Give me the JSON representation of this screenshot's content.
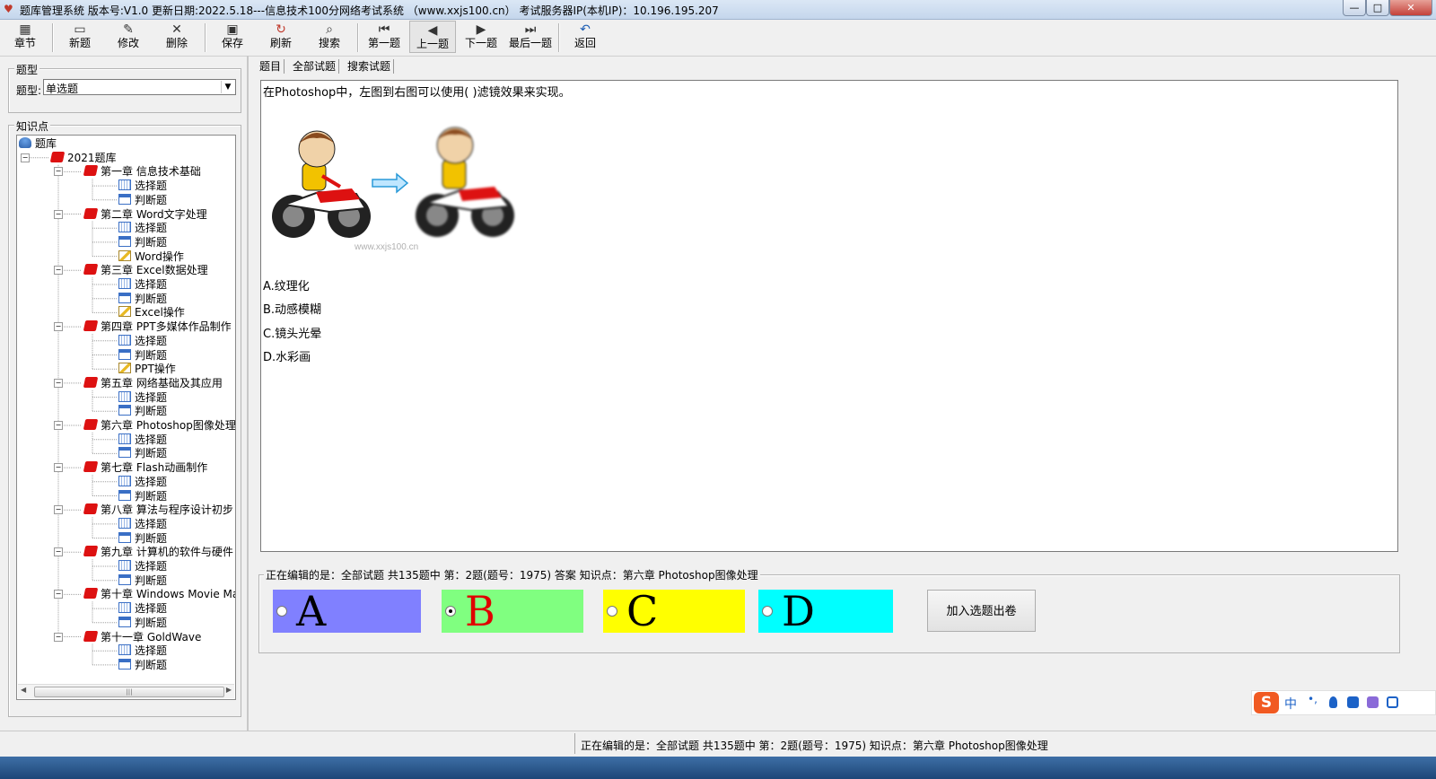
{
  "window": {
    "title": "题库管理系统 版本号:V1.0 更新日期:2022.5.18---信息技术100分网络考试系统 （www.xxjs100.cn） 考试服务器IP(本机IP)：10.196.195.207",
    "min_glyph": "—",
    "max_glyph": "□",
    "close_glyph": "✕"
  },
  "toolbar": {
    "chapter": "章节",
    "new": "新题",
    "modify": "修改",
    "delete": "删除",
    "save": "保存",
    "refresh": "刷新",
    "search": "搜索",
    "first": "第一题",
    "prev": "上一题",
    "next": "下一题",
    "last": "最后一题",
    "back": "返回"
  },
  "left": {
    "type_group_label": "题型",
    "type_label": "题型:",
    "type_value": "单选题",
    "knowledge_label": "知识点",
    "tree": {
      "root": "题库",
      "bank": "2021题库",
      "chapters": [
        {
          "label": "第一章 信息技术基础",
          "children": [
            "选择题",
            "判断题"
          ]
        },
        {
          "label": "第二章 Word文字处理",
          "children": [
            "选择题",
            "判断题",
            "Word操作"
          ]
        },
        {
          "label": "第三章 Excel数据处理",
          "children": [
            "选择题",
            "判断题",
            "Excel操作"
          ]
        },
        {
          "label": "第四章 PPT多媒体作品制作",
          "children": [
            "选择题",
            "判断题",
            "PPT操作"
          ]
        },
        {
          "label": "第五章 网络基础及其应用",
          "children": [
            "选择题",
            "判断题"
          ]
        },
        {
          "label": "第六章 Photoshop图像处理",
          "children": [
            "选择题",
            "判断题"
          ]
        },
        {
          "label": "第七章 Flash动画制作",
          "children": [
            "选择题",
            "判断题"
          ]
        },
        {
          "label": "第八章 算法与程序设计初步",
          "children": [
            "选择题",
            "判断题"
          ]
        },
        {
          "label": "第九章 计算机的软件与硬件",
          "children": [
            "选择题",
            "判断题"
          ]
        },
        {
          "label": "第十章 Windows Movie Maker",
          "children": [
            "选择题",
            "判断题"
          ]
        },
        {
          "label": "第十一章 GoldWave",
          "children": [
            "选择题",
            "判断题"
          ]
        }
      ]
    }
  },
  "tabs": [
    "题目",
    "全部试题",
    "搜索试题"
  ],
  "question": {
    "text": "在Photoshop中，左图到右图可以使用( )滤镜效果来实现。",
    "watermark": "www.xxjs100.cn",
    "options": [
      "A.纹理化",
      "B.动感模糊",
      "C.镜头光晕",
      "D.水彩画"
    ]
  },
  "editing": {
    "legend": "正在编辑的是：全部试题 共135题中  第：2题(题号：1975) 答案 知识点：第六章 Photoshop图像处理",
    "answers": [
      {
        "letter": "A",
        "bg": "#8080ff",
        "color": "#000000",
        "selected": false
      },
      {
        "letter": "B",
        "bg": "#80ff80",
        "color": "#e00000",
        "selected": true
      },
      {
        "letter": "C",
        "bg": "#ffff00",
        "color": "#000000",
        "selected": false
      },
      {
        "letter": "D",
        "bg": "#00ffff",
        "color": "#000000",
        "selected": false
      }
    ],
    "add_button": "加入选题出卷"
  },
  "status": {
    "text": "正在编辑的是：全部试题 共135题中  第：2题(题号：1975)  知识点：第六章 Photoshop图像处理"
  },
  "ime": {
    "logo": "S",
    "mode": "中"
  }
}
